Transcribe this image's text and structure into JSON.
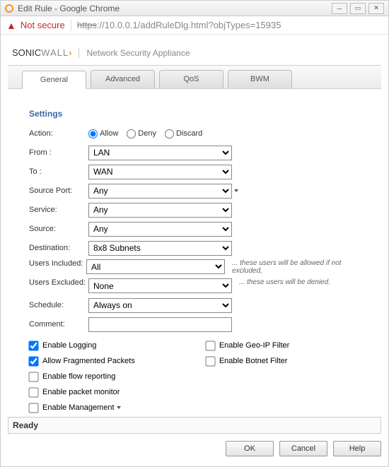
{
  "window": {
    "title": "Edit Rule - Google Chrome",
    "not_secure": "Not secure",
    "url_scheme": "https",
    "url_rest": "://10.0.0.1/addRuleDlg.html?objTypes=15935"
  },
  "brand": {
    "logo_prefix": "SONIC",
    "logo_suffix": "WALL",
    "subtitle": "Network Security Appliance"
  },
  "tabs": [
    {
      "label": "General",
      "active": true
    },
    {
      "label": "Advanced",
      "active": false
    },
    {
      "label": "QoS",
      "active": false
    },
    {
      "label": "BWM",
      "active": false
    }
  ],
  "section_title": "Settings",
  "action": {
    "label": "Action:",
    "options": [
      {
        "label": "Allow",
        "checked": true
      },
      {
        "label": "Deny",
        "checked": false
      },
      {
        "label": "Discard",
        "checked": false
      }
    ]
  },
  "selects": {
    "from": {
      "label": "From :",
      "value": "LAN"
    },
    "to": {
      "label": "To :",
      "value": "WAN"
    },
    "source_port": {
      "label": "Source Port:",
      "value": "Any"
    },
    "service": {
      "label": "Service:",
      "value": "Any"
    },
    "source": {
      "label": "Source:",
      "value": "Any"
    },
    "destination": {
      "label": "Destination:",
      "value": "8x8 Subnets"
    },
    "users_inc": {
      "label": "Users Included:",
      "value": "All",
      "hint": "... these users will be allowed if not excluded,"
    },
    "users_exc": {
      "label": "Users Excluded:",
      "value": "None",
      "hint": "... these users will be denied."
    },
    "schedule": {
      "label": "Schedule:",
      "value": "Always on"
    }
  },
  "comment": {
    "label": "Comment:",
    "value": ""
  },
  "checkboxes_left": [
    {
      "label": "Enable Logging",
      "checked": true
    },
    {
      "label": "Allow Fragmented Packets",
      "checked": true
    },
    {
      "label": "Enable flow reporting",
      "checked": false
    },
    {
      "label": "Enable packet monitor",
      "checked": false
    },
    {
      "label": "Enable Management",
      "checked": false,
      "caret": true
    }
  ],
  "checkboxes_right": [
    {
      "label": "Enable Geo-IP Filter",
      "checked": false
    },
    {
      "label": "Enable Botnet Filter",
      "checked": false
    }
  ],
  "status": "Ready",
  "buttons": {
    "ok": "OK",
    "cancel": "Cancel",
    "help": "Help"
  }
}
